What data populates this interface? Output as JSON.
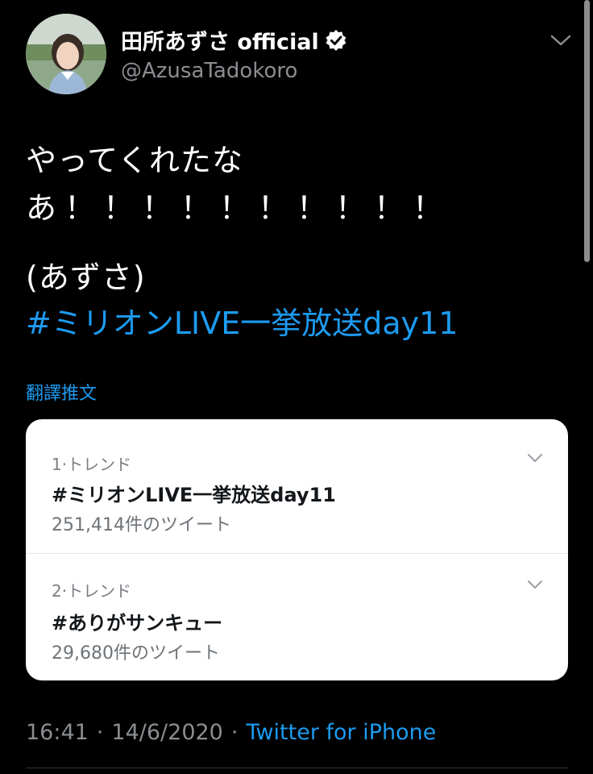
{
  "user": {
    "display_name": "田所あずさ official",
    "handle": "@AzusaTadokoro",
    "verified": true
  },
  "tweet": {
    "line1": "やってくれたな",
    "line2": "あ！！！！！！！！！！",
    "line3": "(あずさ)",
    "hashtag": "#ミリオンLIVE一挙放送day11",
    "translate_label": "翻譯推文"
  },
  "trends": [
    {
      "rank": "1·トレンド",
      "name": "#ミリオンLIVE一挙放送day11",
      "count": "251,414件のツイート"
    },
    {
      "rank": "2·トレンド",
      "name": "#ありがサンキュー",
      "count": "29,680件のツイート"
    }
  ],
  "meta": {
    "time": "16:41",
    "separator": "·",
    "date": "14/6/2020",
    "source": "Twitter for iPhone"
  },
  "colors": {
    "background": "#000000",
    "link": "#1d9bf0",
    "secondary_text": "#8a8d91",
    "card_background": "#ffffff"
  },
  "icons": {
    "verified": "verified-badge-icon",
    "more": "chevron-down-icon"
  }
}
